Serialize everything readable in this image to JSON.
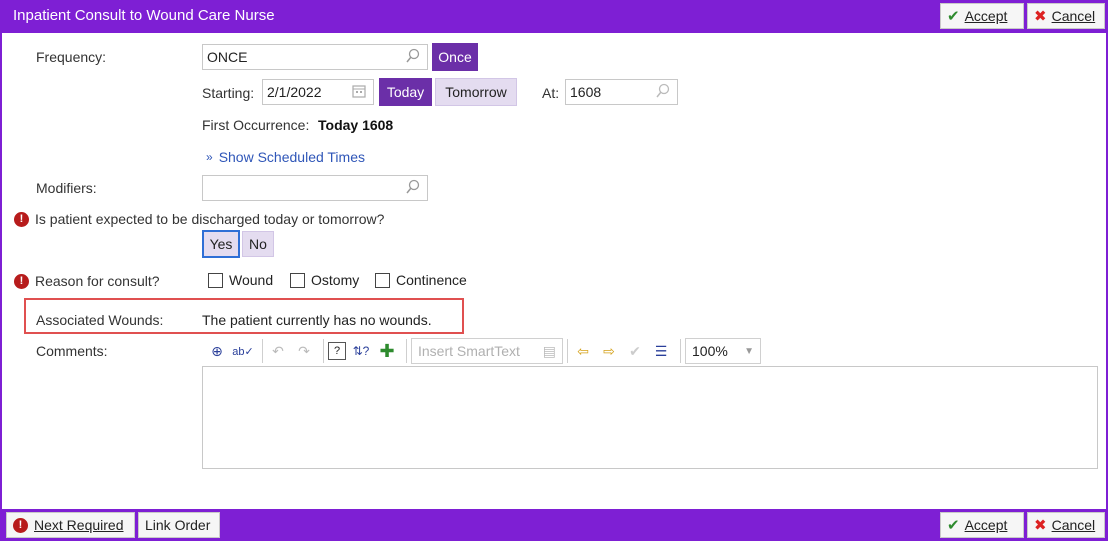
{
  "window": {
    "title": "Inpatient Consult to Wound Care Nurse"
  },
  "header_actions": {
    "accept_label": "Accept",
    "cancel_label": "Cancel"
  },
  "frequency": {
    "label": "Frequency:",
    "value": "ONCE",
    "once_label": "Once"
  },
  "starting": {
    "label": "Starting:",
    "date": "2/1/2022",
    "today_label": "Today",
    "tomorrow_label": "Tomorrow",
    "at_label": "At:",
    "time": "1608"
  },
  "first_occurrence": {
    "label": "First Occurrence:",
    "value": "Today 1608"
  },
  "show_scheduled": {
    "label": "Show Scheduled Times"
  },
  "modifiers": {
    "label": "Modifiers:",
    "value": ""
  },
  "discharge_question": {
    "label": "Is patient expected to be discharged today or tomorrow?",
    "yes_label": "Yes",
    "no_label": "No"
  },
  "reason": {
    "label": "Reason for consult?",
    "options": [
      "Wound",
      "Ostomy",
      "Continence"
    ]
  },
  "associated_wounds": {
    "label": "Associated Wounds:",
    "value": "The patient currently has no wounds."
  },
  "comments": {
    "label": "Comments:",
    "smarttext_placeholder": "Insert SmartText",
    "zoom": "100%"
  },
  "footer": {
    "next_required_label": "Next Required",
    "link_order_label": "Link Order",
    "accept_label": "Accept",
    "cancel_label": "Cancel"
  },
  "colors": {
    "brand": "#7e1fd4",
    "pill_active": "#6b2fa8",
    "pill_inactive": "#e4dcf0",
    "alert": "#b71c1c",
    "highlight_border": "#e05050"
  }
}
